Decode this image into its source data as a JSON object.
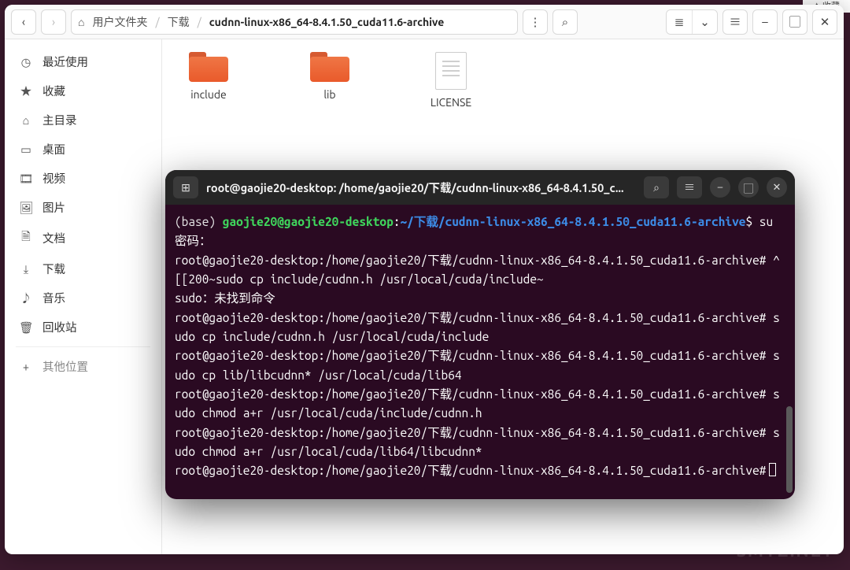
{
  "topright": "✦ 收藏",
  "watermark": "SMYZ.NET",
  "fm": {
    "breadcrumb": {
      "home_icon": "⌂",
      "part1": "用户文件夹",
      "part2": "下载",
      "current": "cudnn-linux-x86_64-8.4.1.50_cuda11.6-archive"
    },
    "sidebar": {
      "recent": {
        "icon": "◷",
        "label": "最近使用"
      },
      "starred": {
        "icon": "★",
        "label": "收藏"
      },
      "home": {
        "icon": "⌂",
        "label": "主目录"
      },
      "desktop": {
        "icon": "▭",
        "label": "桌面"
      },
      "videos": {
        "icon": "🎞",
        "label": "视频"
      },
      "pictures": {
        "icon": "🖼",
        "label": "图片"
      },
      "docs": {
        "icon": "🗎",
        "label": "文档"
      },
      "downloads": {
        "icon": "⤓",
        "label": "下载"
      },
      "music": {
        "icon": "♪",
        "label": "音乐"
      },
      "trash": {
        "icon": "🗑",
        "label": "回收站"
      },
      "other": {
        "icon": "+",
        "label": "其他位置"
      }
    },
    "files": {
      "include": "include",
      "lib": "lib",
      "license": "LICENSE"
    }
  },
  "terminal": {
    "title": "root@gaojie20-desktop: /home/gaojie20/下载/cudnn-linux-x86_64-8.4.1.50_c...",
    "prompt_env": "(base) ",
    "prompt_user": "gaojie20@gaojie20-desktop",
    "prompt_path": "~/下载/cudnn-linux-x86_64-8.4.1.50_cuda11.6-archive",
    "cmd_su": " su",
    "line_pw": "密码：",
    "root_prompt": "root@gaojie20-desktop:/home/gaojie20/下载/cudnn-linux-x86_64-8.4.1.50_cuda11.6-archive#",
    "esc_cmd": " ^[[200~sudo cp include/cudnn.h /usr/local/cuda/include~",
    "err": "sudo：未找到命令",
    "cmd1": " sudo cp include/cudnn.h /usr/local/cuda/include",
    "cmd2": " sudo cp lib/libcudnn* /usr/local/cuda/lib64",
    "cmd3": " sudo chmod a+r /usr/local/cuda/include/cudnn.h",
    "cmd4": " sudo chmod a+r /usr/local/cuda/lib64/libcudnn*"
  }
}
